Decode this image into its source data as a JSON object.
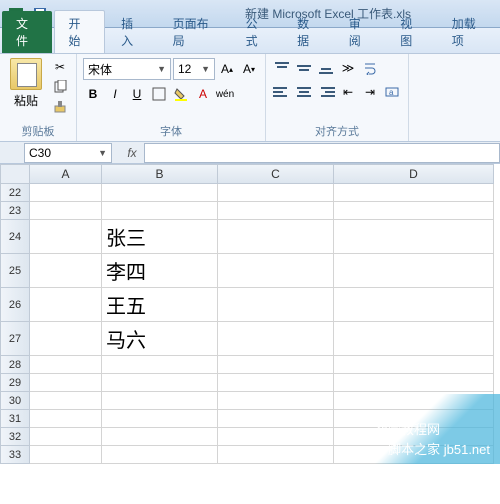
{
  "titlebar": {
    "title": "新建 Microsoft Excel 工作表.xls"
  },
  "tabs": {
    "file": "文件",
    "items": [
      "开始",
      "插入",
      "页面布局",
      "公式",
      "数据",
      "审阅",
      "视图",
      "加载项"
    ]
  },
  "ribbon": {
    "clipboard": {
      "paste": "粘贴",
      "label": "剪贴板"
    },
    "font": {
      "name": "宋体",
      "size": "12",
      "label": "字体",
      "bold": "B",
      "italic": "I",
      "underline": "U"
    },
    "align": {
      "label": "对齐方式"
    }
  },
  "namebox": {
    "ref": "C30",
    "value": ""
  },
  "grid": {
    "cols": [
      "A",
      "B",
      "C",
      "D"
    ],
    "rows": [
      {
        "n": "22",
        "h": "s",
        "cells": [
          "",
          "",
          "",
          ""
        ]
      },
      {
        "n": "23",
        "h": "s",
        "cells": [
          "",
          "",
          "",
          ""
        ]
      },
      {
        "n": "24",
        "h": "b",
        "cells": [
          "",
          "张三",
          "",
          ""
        ]
      },
      {
        "n": "25",
        "h": "b",
        "cells": [
          "",
          "李四",
          "",
          ""
        ]
      },
      {
        "n": "26",
        "h": "b",
        "cells": [
          "",
          "王五",
          "",
          ""
        ]
      },
      {
        "n": "27",
        "h": "b",
        "cells": [
          "",
          "马六",
          "",
          ""
        ]
      },
      {
        "n": "28",
        "h": "s",
        "cells": [
          "",
          "",
          "",
          ""
        ]
      },
      {
        "n": "29",
        "h": "s",
        "cells": [
          "",
          "",
          "",
          ""
        ]
      },
      {
        "n": "30",
        "h": "s",
        "cells": [
          "",
          "",
          "",
          ""
        ]
      },
      {
        "n": "31",
        "h": "s",
        "cells": [
          "",
          "",
          "",
          ""
        ]
      },
      {
        "n": "32",
        "h": "s",
        "cells": [
          "",
          "",
          "",
          ""
        ]
      },
      {
        "n": "33",
        "h": "s",
        "cells": [
          "",
          "",
          "",
          ""
        ]
      }
    ]
  },
  "watermark": {
    "site": "jb51.net",
    "sub": "脚本之家",
    "tag": "智学教程网"
  }
}
